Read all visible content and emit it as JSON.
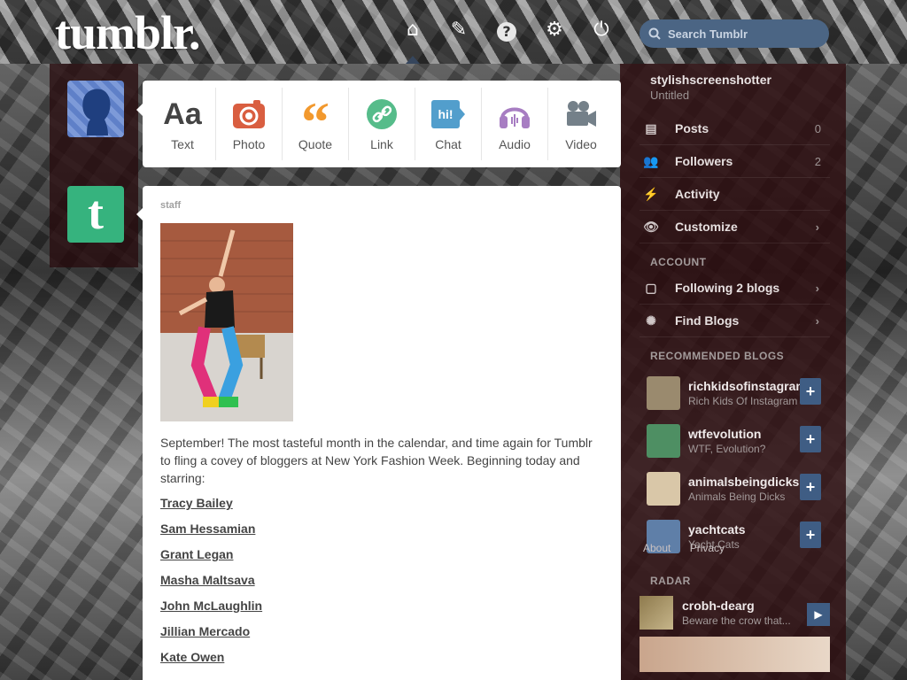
{
  "header": {
    "logo_text": "tumblr.",
    "search_placeholder": "Search Tumblr"
  },
  "post_types": [
    {
      "label": "Text",
      "icon": "text-icon",
      "color": "#444444"
    },
    {
      "label": "Photo",
      "icon": "camera-icon",
      "color": "#d95e40"
    },
    {
      "label": "Quote",
      "icon": "quote-icon",
      "color": "#f2992e"
    },
    {
      "label": "Link",
      "icon": "link-icon",
      "color": "#56bc8a"
    },
    {
      "label": "Chat",
      "icon": "chat-icon",
      "color": "#529ecc"
    },
    {
      "label": "Audio",
      "icon": "headphones-icon",
      "color": "#a77dc2"
    },
    {
      "label": "Video",
      "icon": "video-camera-icon",
      "color": "#748089"
    }
  ],
  "post": {
    "author": "staff",
    "body": "September! The most tasteful month in the calendar, and time again for Tumblr to fling a covey of bloggers at New York Fashion Week. Beginning today and starring:",
    "links": [
      "Tracy Bailey",
      "Sam Hessamian",
      "Grant Legan",
      "Masha Maltsava",
      "John McLaughlin",
      "Jillian Mercado",
      "Kate Owen"
    ]
  },
  "sidebar": {
    "blog_name": "stylishscreenshotter",
    "blog_subtitle": "Untitled",
    "blog_items": [
      {
        "label": "Posts",
        "count": "0",
        "icon": "posts-icon"
      },
      {
        "label": "Followers",
        "count": "2",
        "icon": "followers-icon"
      },
      {
        "label": "Activity",
        "count": "",
        "icon": "activity-icon"
      },
      {
        "label": "Customize",
        "count": "",
        "icon": "eye-icon"
      }
    ],
    "account_head": "ACCOUNT",
    "account_items": [
      {
        "label": "Following 2 blogs",
        "icon": "following-icon"
      },
      {
        "label": "Find Blogs",
        "icon": "compass-icon"
      }
    ],
    "recommended_head": "RECOMMENDED BLOGS",
    "recommended": [
      {
        "name": "richkidsofinstagram",
        "subtitle": "Rich Kids Of Instagram",
        "thumb_color": "#9a8a6e"
      },
      {
        "name": "wtfevolution",
        "subtitle": "WTF, Evolution?",
        "thumb_color": "#4e8f63"
      },
      {
        "name": "animalsbeingdicks",
        "subtitle": "Animals Being Dicks",
        "thumb_color": "#d9c7a8"
      },
      {
        "name": "yachtcats",
        "subtitle": "Yacht Cats",
        "thumb_color": "#5f7fa8"
      }
    ],
    "follow_label": "+",
    "footer_links": [
      "About",
      "Privacy"
    ],
    "radar_head": "RADAR",
    "radar": {
      "name": "crobh-dearg",
      "subtitle": "Beware the crow that..."
    }
  }
}
